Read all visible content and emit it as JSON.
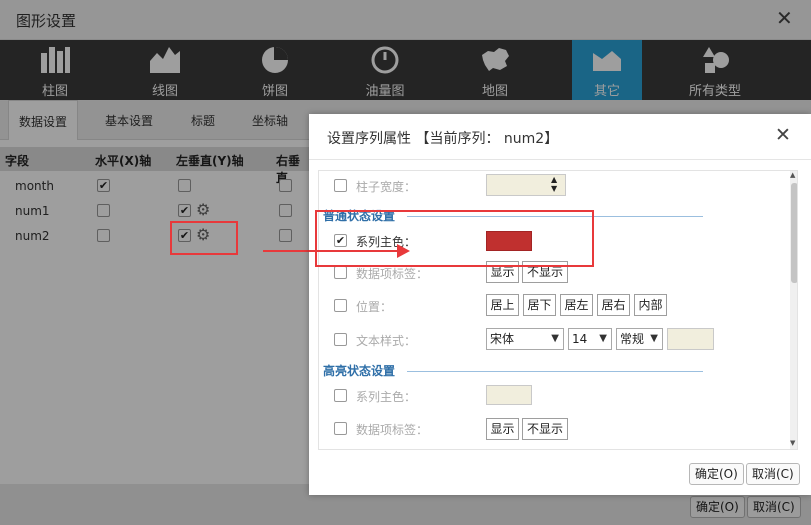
{
  "window": {
    "title": "图形设置",
    "close_icon": "close-icon"
  },
  "chart_types": [
    {
      "label": "柱图",
      "icon": "bar-chart-icon"
    },
    {
      "label": "线图",
      "icon": "line-chart-icon"
    },
    {
      "label": "饼图",
      "icon": "pie-chart-icon"
    },
    {
      "label": "油量图",
      "icon": "gauge-icon"
    },
    {
      "label": "地图",
      "icon": "map-icon"
    },
    {
      "label": "其它",
      "icon": "other-chart-icon",
      "active": true
    },
    {
      "label": "所有类型",
      "icon": "all-types-icon"
    }
  ],
  "sub_tabs": [
    "数据设置",
    "基本设置",
    "标题",
    "坐标轴"
  ],
  "grid": {
    "headers": [
      "字段",
      "水平(X)轴",
      "左垂直(Y)轴",
      "右垂直"
    ],
    "rows": [
      {
        "field": "month",
        "x": true,
        "y": false,
        "right": false
      },
      {
        "field": "num1",
        "x": false,
        "y": true,
        "right": false
      },
      {
        "field": "num2",
        "x": false,
        "y": true,
        "right": false
      }
    ]
  },
  "footer": {
    "ok_label": "确定(O)",
    "cancel_label": "取消(C)"
  },
  "modal": {
    "title": "设置序列属性 【当前序列： num2】",
    "column_width_label": "柱子宽度：",
    "normal_section": "普通状态设置",
    "series_color_label": "系列主色：",
    "series_color": "#c0302f",
    "data_label_label": "数据项标签：",
    "show_label": "显示",
    "hide_label": "不显示",
    "position_label": "位置：",
    "positions": [
      "居上",
      "居下",
      "居左",
      "居右",
      "内部"
    ],
    "text_style_label": "文本样式：",
    "font_value": "宋体",
    "size_value": "14",
    "weight_value": "常规",
    "highlight_section": "高亮状态设置",
    "hl_series_color_label": "系列主色：",
    "hl_data_label_label": "数据项标签：",
    "hl_show_label": "显示",
    "hl_hide_label": "不显示",
    "ok_label": "确定(O)",
    "cancel_label": "取消(C)"
  },
  "colors": {
    "accent": "#2aa3d8",
    "annotation": "#e8393b",
    "section": "#2f6fa8"
  }
}
